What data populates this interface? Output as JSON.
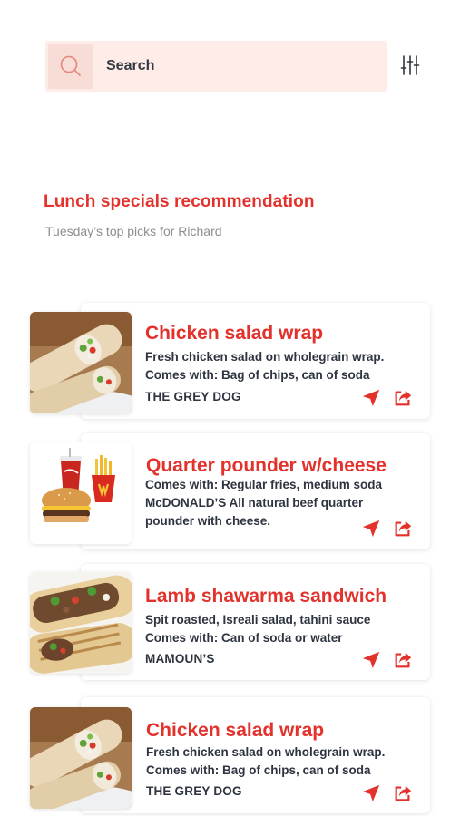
{
  "search": {
    "placeholder": "Search"
  },
  "icons": {
    "search": "search-icon",
    "filter": "sliders-icon",
    "navigate": "navigation-arrow-icon",
    "share": "share-icon"
  },
  "colors": {
    "accent": "#e3312c",
    "search_bg": "#fdece8",
    "text_dark": "#2e3440",
    "text_muted": "#8e8e8e"
  },
  "section": {
    "title": "Lunch specials recommendation",
    "subtitle": "Tuesday’s top picks for Richard"
  },
  "items": [
    {
      "title": "Chicken salad wrap",
      "lines": [
        "Fresh chicken salad on wholegrain wrap.",
        "Comes with: Bag of chips, can of soda"
      ],
      "store": "THE GREY DOG",
      "image": "chicken-wrap-image"
    },
    {
      "title": "Quarter pounder w/cheese",
      "lines": [
        "Comes with: Regular fries, medium soda",
        "McDONALD’S All natural beef quarter",
        "pounder with cheese."
      ],
      "store": "",
      "image": "burger-meal-image"
    },
    {
      "title": "Lamb shawarma sandwich",
      "lines": [
        "Spit roasted, Isreali salad, tahini sauce",
        "Comes with: Can of soda or water"
      ],
      "store": "MAMOUN’S",
      "image": "shawarma-image"
    },
    {
      "title": "Chicken salad wrap",
      "lines": [
        "Fresh chicken salad on wholegrain wrap.",
        "Comes with: Bag of chips, can of soda"
      ],
      "store": "THE GREY DOG",
      "image": "chicken-wrap-image"
    }
  ]
}
